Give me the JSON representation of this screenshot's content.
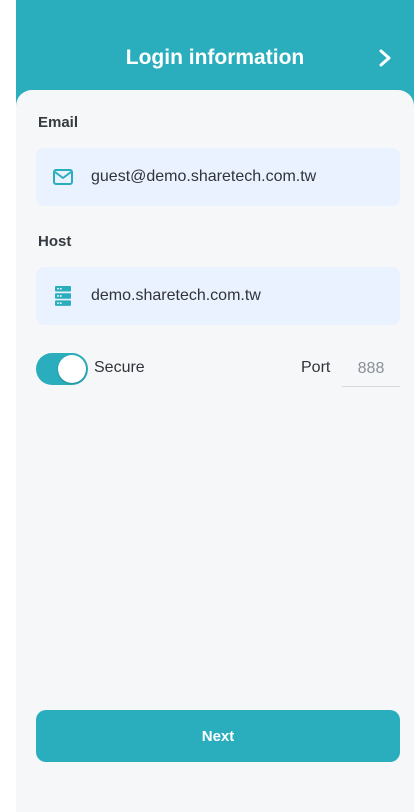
{
  "header": {
    "title": "Login information",
    "next_icon": "chevron-right-icon"
  },
  "email": {
    "label": "Email",
    "value": "guest@demo.sharetech.com.tw",
    "icon": "mail-icon"
  },
  "host": {
    "label": "Host",
    "value": "demo.sharetech.com.tw",
    "icon": "server-icon"
  },
  "secure": {
    "label": "Secure",
    "enabled": true
  },
  "port": {
    "label": "Port",
    "value": "888"
  },
  "footer": {
    "next_label": "Next"
  },
  "colors": {
    "accent": "#2aaebd",
    "field_background": "#eaf1ff",
    "sheet_background": "#f6f7f9"
  }
}
